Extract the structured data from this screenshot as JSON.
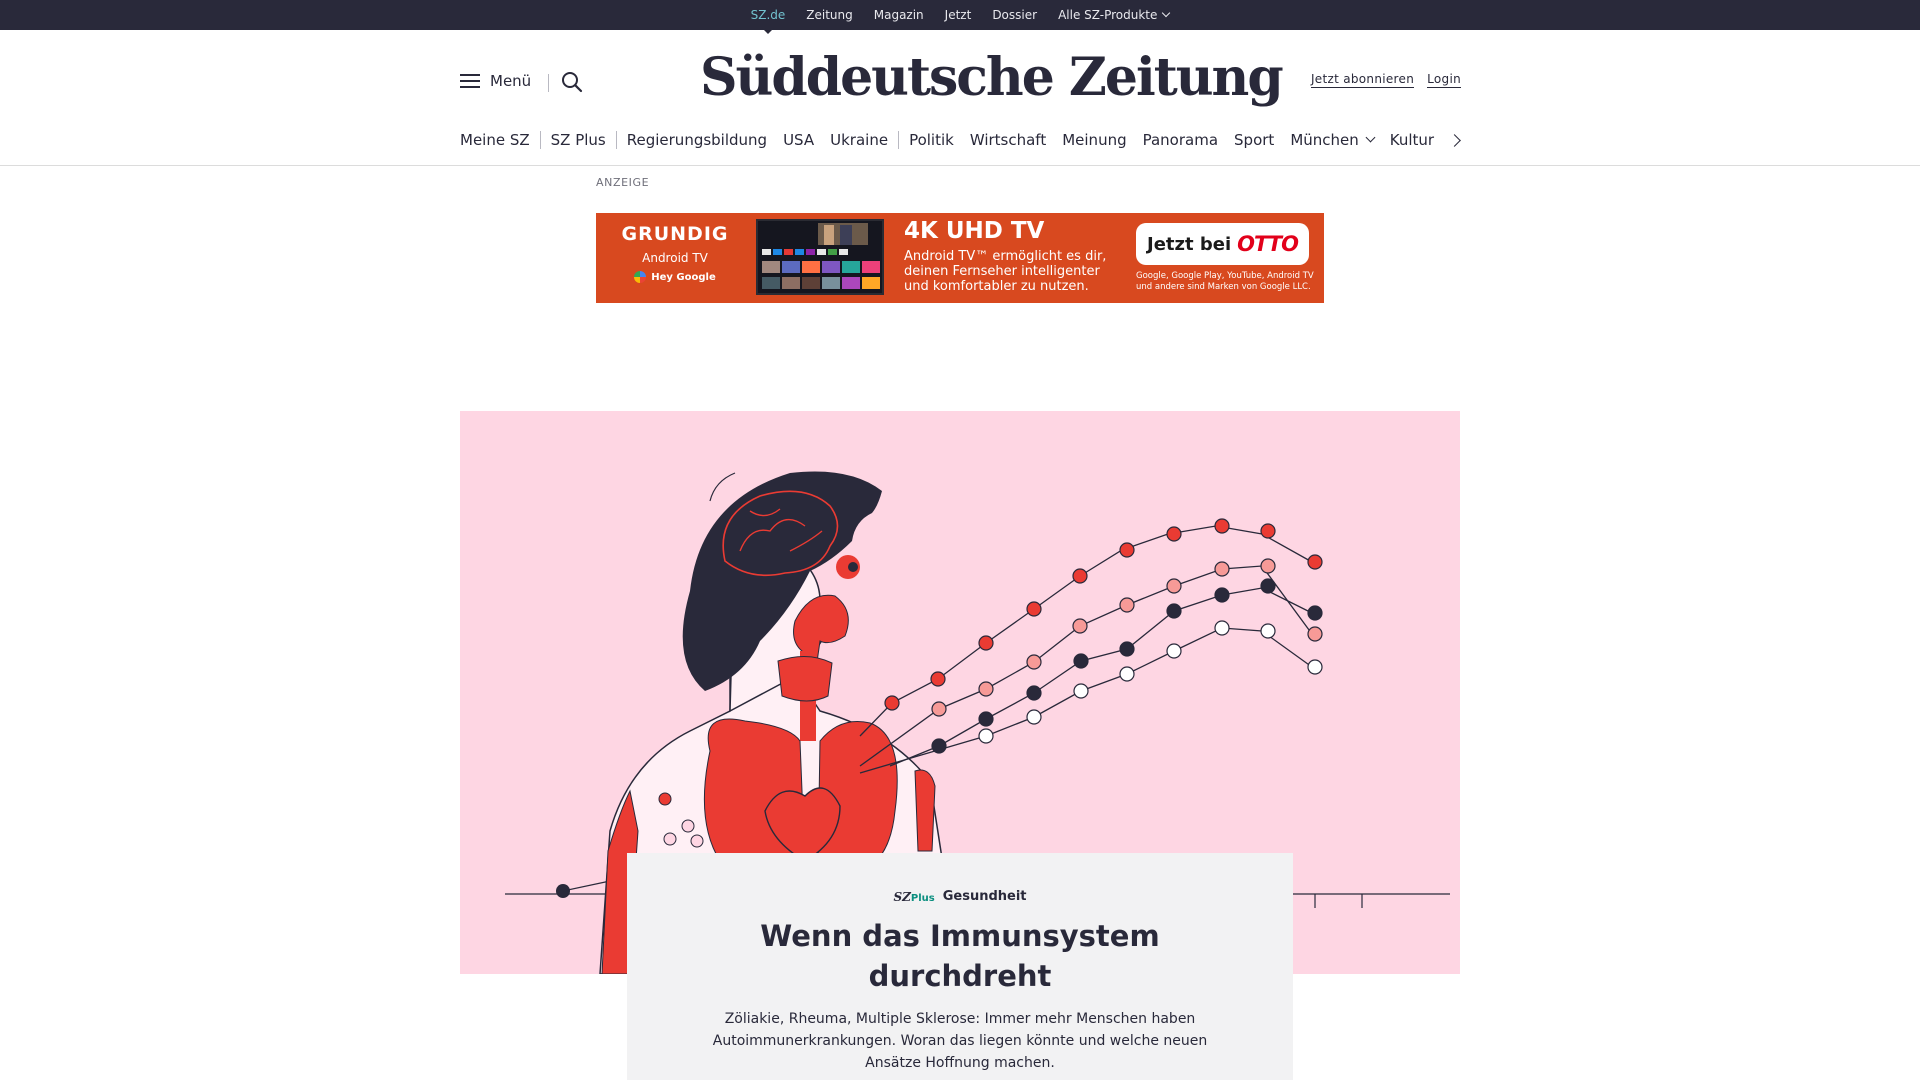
{
  "topbar": {
    "links": [
      {
        "label": "SZ.de",
        "active": true
      },
      {
        "label": "Zeitung",
        "active": false
      },
      {
        "label": "Magazin",
        "active": false
      },
      {
        "label": "Jetzt",
        "active": false
      },
      {
        "label": "Dossier",
        "active": false
      },
      {
        "label": "Alle SZ-Produkte",
        "active": false,
        "dropdown": true
      }
    ]
  },
  "header": {
    "menu_label": "Menü",
    "search_icon": "search-icon",
    "logo_text": "Süddeutsche Zeitung",
    "subscribe_label": "Jetzt abonnieren",
    "login_label": "Login"
  },
  "nav": {
    "items": [
      "Meine SZ",
      "SZ Plus",
      "Regierungsbildung",
      "USA",
      "Ukraine",
      "Politik",
      "Wirtschaft",
      "Meinung",
      "Panorama",
      "Sport",
      "München",
      "Kultur"
    ],
    "next_icon": "chevron-right-icon"
  },
  "ad": {
    "label": "ANZEIGE",
    "brand": "GRUNDIG",
    "brand_sub": "Android TV",
    "assistant": "Hey Google",
    "headline": "4K UHD TV",
    "text": "Android TV™ ermöglicht es dir, deinen Fernseher intelligenter und komfortabler zu nutzen.",
    "cta_prefix": "Jetzt bei",
    "cta_brand": "OTTO",
    "legal": "Google, Google Play, YouTube, Android TV und andere sind Marken von Google LLC."
  },
  "teaser": {
    "brand": "SZ",
    "brand_plus": "Plus",
    "kicker": "Gesundheit",
    "headline": "Wenn das Immunsystem durchdreht",
    "text": "Zöliakie, Rheuma, Multiple Sklerose: Immer mehr Menschen haben Autoimmunerkrankungen. Woran das liegen könnte und welche neuen Ansätze Hoffnung machen."
  },
  "colors": {
    "dark": "#29293a",
    "accent": "#72c2cf",
    "hero_bg": "#fed6e3",
    "red": "#ea3b33",
    "ad_bg": "#d8491f"
  }
}
